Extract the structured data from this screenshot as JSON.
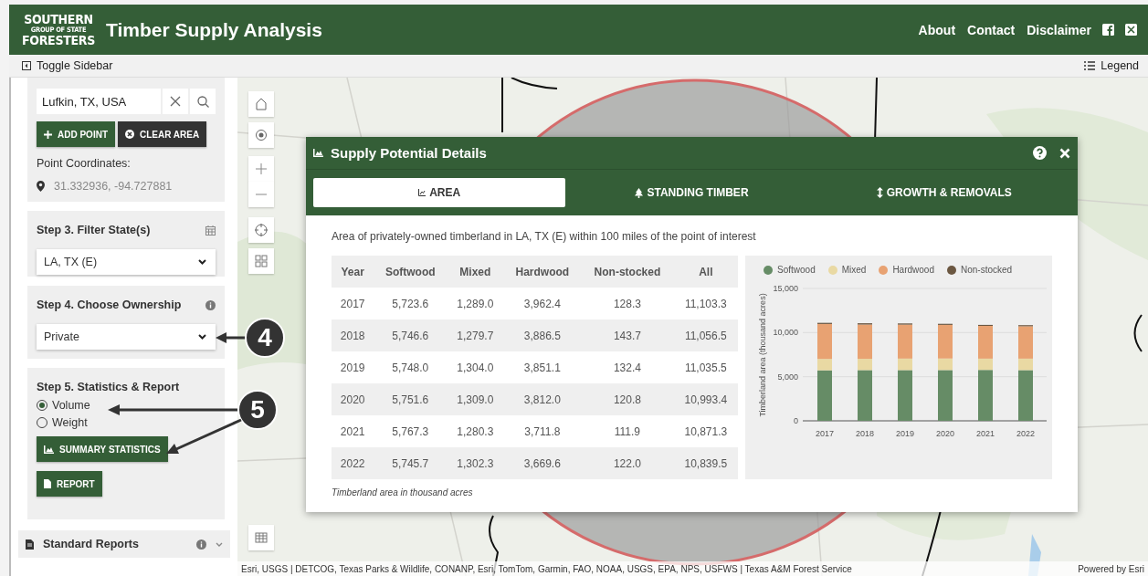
{
  "header": {
    "logo": {
      "line_1": "SOUTHERN",
      "line_2": "GROUP OF STATE",
      "line_3": "FORESTERS"
    },
    "title": "Timber Supply Analysis",
    "nav": [
      "About",
      "Contact",
      "Disclaimer"
    ]
  },
  "toolbar": {
    "toggle": "Toggle Sidebar",
    "legend": "Legend"
  },
  "sidebar": {
    "location_search": {
      "value": "Lufkin, TX, USA"
    },
    "buttons": [
      {
        "label": "ADD POINT",
        "kind": "add"
      },
      {
        "label": "CLEAR AREA",
        "kind": "clear"
      }
    ],
    "coordinates_label": "Point Coordinates:",
    "coordinates": "31.332936, -94.727881",
    "step3": {
      "title": "Step 3. Filter State(s)",
      "select": "LA, TX (E)"
    },
    "step4": {
      "title": "Step 4. Choose Ownership",
      "select": "Private"
    },
    "step5": {
      "title": "Step 5. Statistics & Report",
      "options": [
        {
          "label": "Volume",
          "selected": true
        },
        {
          "label": "Weight",
          "selected": false
        }
      ],
      "buttons": [
        {
          "label": "SUMMARY STATISTICS",
          "kind": "chart"
        },
        {
          "label": "REPORT",
          "kind": "file"
        }
      ]
    },
    "standard_reports": {
      "title": "Standard Reports"
    }
  },
  "callouts": [
    "4",
    "5"
  ],
  "map": {
    "attribution": "Esri, USGS | DETCOG, Texas Parks & Wildlife, CONANP, Esri, TomTom, Garmin, FAO, NOAA, USGS, EPA, NPS, USFWS | Texas A&M Forest Service",
    "powered_by": "Powered by Esri"
  },
  "dialog": {
    "title": "Supply Potential Details",
    "tabs": [
      {
        "label": "AREA",
        "kind": "area",
        "selected": true
      },
      {
        "label": "STANDING TIMBER",
        "kind": "tree",
        "selected": false
      },
      {
        "label": "GROWTH & REMOVALS",
        "kind": "updown",
        "selected": false
      }
    ],
    "description": "Area of privately-owned timberland in LA, TX (E) within 100 miles of the point of interest",
    "table": {
      "columns": [
        "Year",
        "Softwood",
        "Mixed",
        "Hardwood",
        "Non-stocked",
        "All"
      ],
      "rows": [
        [
          "2017",
          "5,723.6",
          "1,289.0",
          "3,962.4",
          "128.3",
          "11,103.3"
        ],
        [
          "2018",
          "5,746.6",
          "1,279.7",
          "3,886.5",
          "143.7",
          "11,056.5"
        ],
        [
          "2019",
          "5,748.0",
          "1,304.0",
          "3,851.1",
          "132.4",
          "11,035.5"
        ],
        [
          "2020",
          "5,751.6",
          "1,309.0",
          "3,812.0",
          "120.8",
          "10,993.4"
        ],
        [
          "2021",
          "5,767.3",
          "1,280.3",
          "3,711.8",
          "111.9",
          "10,871.3"
        ],
        [
          "2022",
          "5,745.7",
          "1,302.3",
          "3,669.6",
          "122.0",
          "10,839.5"
        ]
      ]
    },
    "note": "Timberland area in thousand acres",
    "chart_data": {
      "type": "bar",
      "stacked": true,
      "legend": true,
      "ylabel": "Timberland area (thousand acres)",
      "categories": [
        "2017",
        "2018",
        "2019",
        "2020",
        "2021",
        "2022"
      ],
      "series": [
        {
          "name": "Softwood",
          "color": "#668c66",
          "values": [
            5723.6,
            5746.6,
            5748.0,
            5751.6,
            5767.3,
            5745.7
          ]
        },
        {
          "name": "Mixed",
          "color": "#e9d9a3",
          "values": [
            1289.0,
            1279.7,
            1304.0,
            1309.0,
            1280.3,
            1302.3
          ]
        },
        {
          "name": "Hardwood",
          "color": "#e8a272",
          "values": [
            3962.4,
            3886.5,
            3851.1,
            3812.0,
            3711.8,
            3669.6
          ]
        },
        {
          "name": "Non-stocked",
          "color": "#6b5741",
          "values": [
            128.3,
            143.7,
            132.4,
            120.8,
            111.9,
            122.0
          ]
        }
      ],
      "ylim": [
        0,
        15000
      ],
      "yticks": [
        {
          "value": 0,
          "label": "0"
        },
        {
          "value": 5000,
          "label": "5,000"
        },
        {
          "value": 10000,
          "label": "10,000"
        },
        {
          "value": 15000,
          "label": "15,000"
        }
      ]
    }
  }
}
